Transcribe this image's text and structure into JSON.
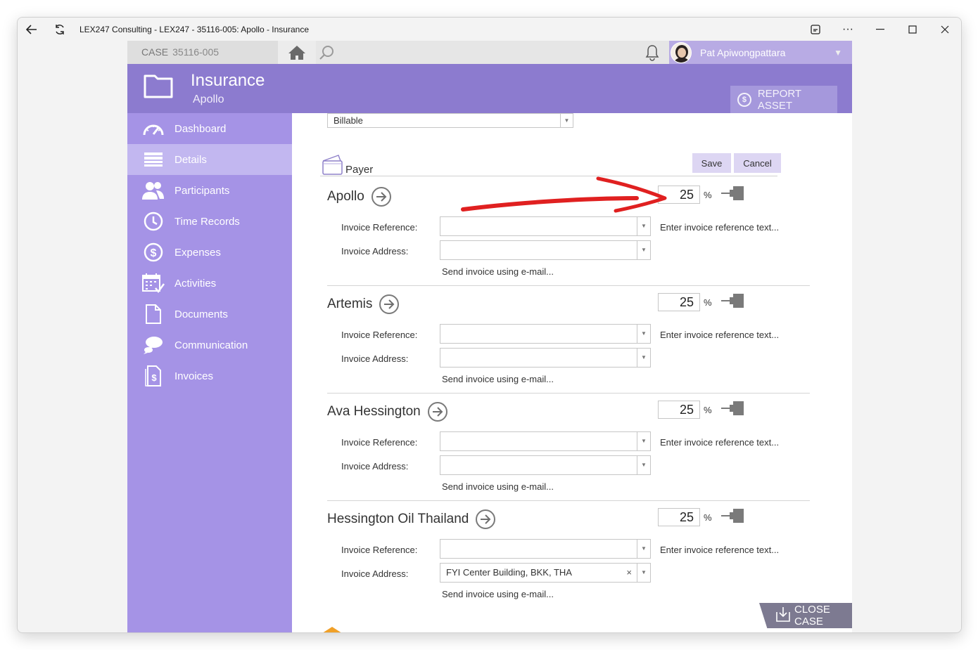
{
  "window": {
    "title": "LEX247 Consulting - LEX247 - 35116-005: Apollo - Insurance"
  },
  "topbar": {
    "case_label": "CASE",
    "case_number": "35116-005",
    "user_name": "Pat Apiwongpattara"
  },
  "header": {
    "title": "Insurance",
    "subtitle": "Apollo",
    "report_asset_label": "REPORT ASSET"
  },
  "sidebar": {
    "items": [
      {
        "label": "Dashboard",
        "icon": "gauge-icon"
      },
      {
        "label": "Details",
        "icon": "list-icon",
        "active": true
      },
      {
        "label": "Participants",
        "icon": "people-icon"
      },
      {
        "label": "Time Records",
        "icon": "clock-icon"
      },
      {
        "label": "Expenses",
        "icon": "dollar-icon"
      },
      {
        "label": "Activities",
        "icon": "calendar-icon"
      },
      {
        "label": "Documents",
        "icon": "document-icon"
      },
      {
        "label": "Communication",
        "icon": "chat-icon"
      },
      {
        "label": "Invoices",
        "icon": "invoice-icon"
      }
    ]
  },
  "billing": {
    "value": "Billable"
  },
  "payer_section": {
    "title": "Payer",
    "save_label": "Save",
    "cancel_label": "Cancel",
    "percent_sign": "%",
    "invoice_reference_label": "Invoice Reference:",
    "invoice_address_label": "Invoice Address:",
    "reference_hint": "Enter invoice reference text...",
    "email_link": "Send invoice using e-mail...",
    "payers": [
      {
        "name": "Apollo",
        "percent": "25",
        "reference": "",
        "address": ""
      },
      {
        "name": "Artemis",
        "percent": "25",
        "reference": "",
        "address": ""
      },
      {
        "name": "Ava Hessington",
        "percent": "25",
        "reference": "",
        "address": ""
      },
      {
        "name": "Hessington Oil Thailand",
        "percent": "25",
        "reference": "",
        "address": "FYI Center Building, BKK, THA"
      }
    ]
  },
  "close_case_label": "CLOSE CASE",
  "colors": {
    "header": "#8c7bcf",
    "sidebar": "#a593e6",
    "sidebar_active": "#c2b7f0",
    "annotation_arrow": "#e02020"
  }
}
